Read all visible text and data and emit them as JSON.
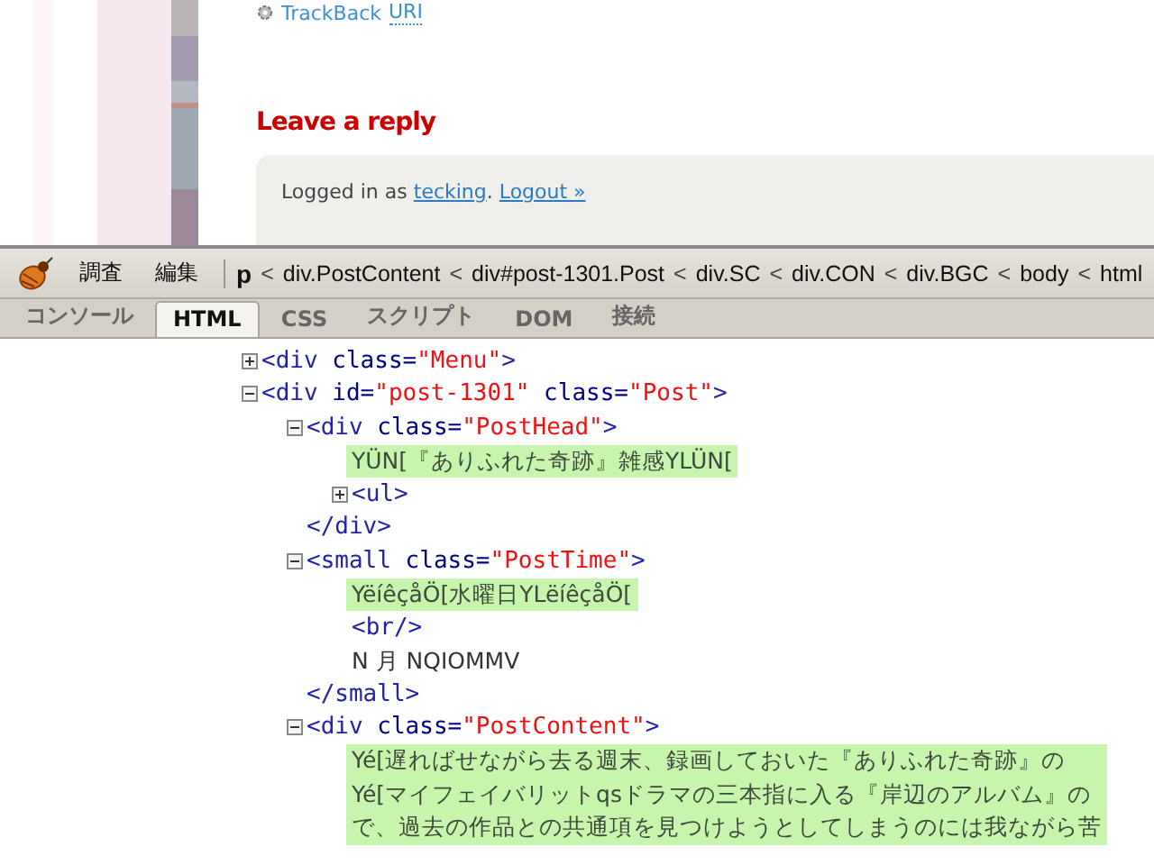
{
  "page": {
    "trackback": {
      "text": "TrackBack",
      "link": "URI"
    },
    "reply_heading": "Leave a reply",
    "login": {
      "prefix": "Logged in as",
      "user": "tecking",
      "dot": ".",
      "logout": "Logout »"
    }
  },
  "toolbar": {
    "buttons": [
      "調査",
      "編集"
    ],
    "breadcrumbs": [
      {
        "label": "p",
        "selected": true
      },
      {
        "separator": "<",
        "label": "div.PostContent",
        "selected": false
      },
      {
        "separator": "<",
        "label": "div#post-1301.Post",
        "selected": false
      },
      {
        "separator": "<",
        "label": "div.SC",
        "selected": false
      },
      {
        "separator": "<",
        "label": "div.CON",
        "selected": false
      },
      {
        "separator": "<",
        "label": "div.BGC",
        "selected": false
      },
      {
        "separator": "<",
        "label": "body",
        "selected": false
      },
      {
        "separator": "<",
        "label": "html",
        "selected": false
      }
    ]
  },
  "tabs": [
    {
      "label": "コンソール",
      "selected": false
    },
    {
      "label": "HTML",
      "selected": true
    },
    {
      "label": "CSS",
      "selected": false
    },
    {
      "label": "スクリプト",
      "selected": false
    },
    {
      "label": "DOM",
      "selected": false
    },
    {
      "label": "接続",
      "selected": false
    }
  ],
  "tree": [
    {
      "kind": "element",
      "expanded": false,
      "tokens": [
        {
          "kind": "tag",
          "text": "<div"
        },
        {
          "kind": "attr",
          "text": " class="
        },
        {
          "kind": "value",
          "text": "\"Menu\""
        },
        {
          "kind": "tag",
          "text": ">"
        }
      ]
    },
    {
      "kind": "element",
      "expanded": true,
      "tokens": [
        {
          "kind": "tag",
          "text": "<div"
        },
        {
          "kind": "attr",
          "text": " id="
        },
        {
          "kind": "value",
          "text": "\"post-1301\""
        },
        {
          "kind": "attr",
          "text": " class="
        },
        {
          "kind": "value",
          "text": "\"Post\""
        },
        {
          "kind": "tag",
          "text": ">"
        }
      ],
      "children": [
        {
          "kind": "element",
          "expanded": true,
          "tokens": [
            {
              "kind": "tag",
              "text": "<div"
            },
            {
              "kind": "attr",
              "text": " class="
            },
            {
              "kind": "value",
              "text": "\"PostHead\""
            },
            {
              "kind": "tag",
              "text": ">"
            }
          ],
          "children": [
            {
              "kind": "text",
              "highlighted": true,
              "lines": [
                "YÜN[『ありふれた奇跡』雑感YLÜN["
              ]
            },
            {
              "kind": "element",
              "expanded": false,
              "tokens": [
                {
                  "kind": "tag",
                  "text": "<ul>"
                }
              ]
            }
          ],
          "closing": "</div>"
        },
        {
          "kind": "element",
          "expanded": true,
          "tokens": [
            {
              "kind": "tag",
              "text": "<small"
            },
            {
              "kind": "attr",
              "text": " class="
            },
            {
              "kind": "value",
              "text": "\"PostTime\""
            },
            {
              "kind": "tag",
              "text": ">"
            }
          ],
          "children": [
            {
              "kind": "text",
              "highlighted": true,
              "lines": [
                "YëíêçåÖ[水曜日YLëíêçåÖ["
              ]
            },
            {
              "kind": "element",
              "tokens": [
                {
                  "kind": "tag",
                  "text": "<br/>"
                }
              ]
            },
            {
              "kind": "text",
              "highlighted": false,
              "lines": [
                "N 月 NQIOMMV"
              ]
            }
          ],
          "closing": "</small>"
        },
        {
          "kind": "element",
          "expanded": true,
          "tokens": [
            {
              "kind": "tag",
              "text": "<div"
            },
            {
              "kind": "attr",
              "text": " class="
            },
            {
              "kind": "value",
              "text": "\"PostContent\""
            },
            {
              "kind": "tag",
              "text": ">"
            }
          ],
          "children": [
            {
              "kind": "text",
              "highlighted": true,
              "lines": [
                "Yé[遅ればせながら去る週末、録画しておいた『ありふれた奇跡』の",
                "Yé[マイフェイバリットqsドラマの三本指に入る『岸辺のアルバム』の",
                "で、過去の作品との共通項を見つけようとしてしまうのには我ながら苦"
              ]
            }
          ]
        }
      ]
    }
  ]
}
